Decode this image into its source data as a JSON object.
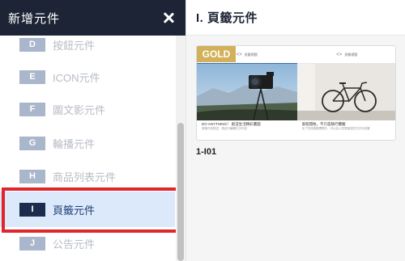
{
  "left_panel": {
    "title": "新增元件",
    "items": [
      {
        "letter": "D",
        "label": "按鈕元件"
      },
      {
        "letter": "E",
        "label": "ICON元件"
      },
      {
        "letter": "F",
        "label": "圖文影元件"
      },
      {
        "letter": "G",
        "label": "輪播元件"
      },
      {
        "letter": "H",
        "label": "商品列表元件"
      },
      {
        "letter": "I",
        "label": "頁籤元件"
      },
      {
        "letter": "J",
        "label": "公告元件"
      }
    ],
    "active_item": "I"
  },
  "right_panel": {
    "title": "I. 頁籤元件",
    "card": {
      "badge": "GOLD",
      "tabs": [
        "頁籤標題",
        "頁籤標題"
      ],
      "captions": [
        {
          "title": "DO ANYTHING！ 創造生活精彩畫面",
          "desc": "頁籤內容敘述，請自行編輯文字內容"
        },
        {
          "title": "旅程開始，不只是騎行體驗",
          "desc": "除了完成頁籤標題外，可以加入您想描述的文字內容喔"
        }
      ],
      "label": "1-I01"
    }
  },
  "colors": {
    "header_bg": "#1c2435",
    "badge_bg": "#a9b6cb",
    "active_bg": "#dce9fa",
    "highlight": "#e0262a",
    "gold": "#d2b15a"
  }
}
